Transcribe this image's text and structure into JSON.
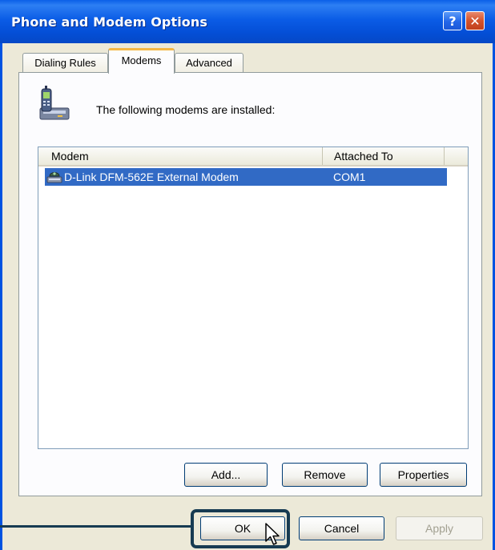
{
  "window": {
    "title": "Phone and Modem Options",
    "help_label": "?",
    "close_label": "✕"
  },
  "tabs": [
    {
      "label": "Dialing Rules",
      "selected": false
    },
    {
      "label": "Modems",
      "selected": true
    },
    {
      "label": "Advanced",
      "selected": false
    }
  ],
  "modems_tab": {
    "installed_text": "The following modems are  installed:",
    "list": {
      "columns": [
        "Modem",
        "Attached To"
      ],
      "rows": [
        {
          "modem": "D-Link DFM-562E External Modem",
          "attached_to": "COM1",
          "selected": true
        }
      ]
    },
    "buttons": {
      "add": "Add...",
      "remove": "Remove",
      "properties": "Properties"
    }
  },
  "dialog_buttons": {
    "ok": "OK",
    "cancel": "Cancel",
    "apply": "Apply"
  },
  "colors": {
    "titlebar": "#0b5ce6",
    "selection": "#316ac5",
    "highlight_frame": "#173b52",
    "active_tab_accent": "#f5b845"
  },
  "icons": {
    "header": "modem-phone-icon",
    "row": "modem-device-icon",
    "cursor": "mouse-pointer-icon"
  }
}
